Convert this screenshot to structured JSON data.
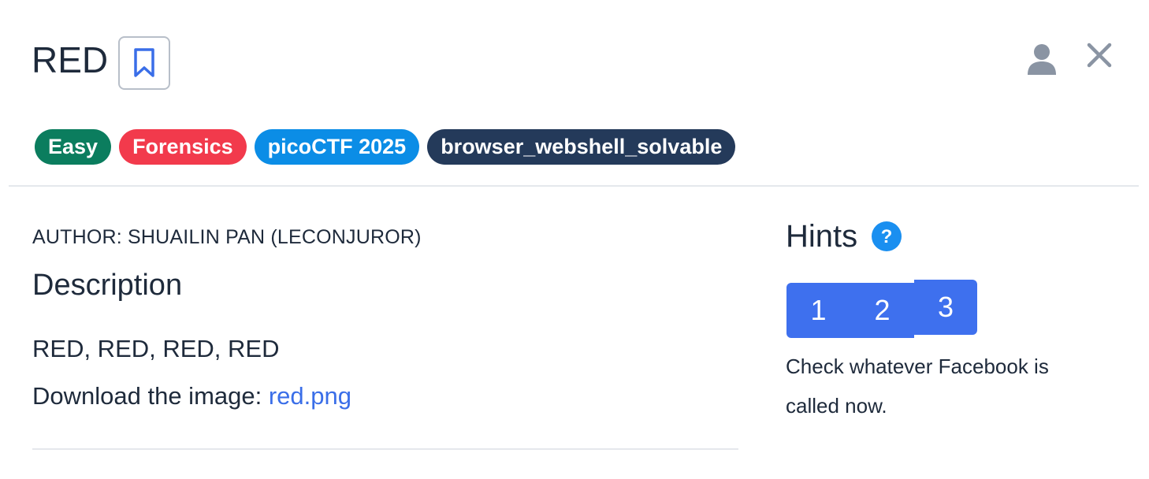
{
  "challenge": {
    "title": "RED",
    "author": "AUTHOR: SHUAILIN PAN (LECONJUROR)"
  },
  "header": {
    "bookmark_icon": "bookmark-icon",
    "user_icon": "user-icon",
    "close_icon": "close-icon"
  },
  "tags": [
    {
      "label": "Easy",
      "color": "#0b7d5e"
    },
    {
      "label": "Forensics",
      "color": "#f23a4c"
    },
    {
      "label": "picoCTF 2025",
      "color": "#0b8de6"
    },
    {
      "label": "browser_webshell_solvable",
      "color": "#243a5a"
    }
  ],
  "description": {
    "heading": "Description",
    "text": "RED, RED, RED, RED",
    "download_prefix": "Download the image: ",
    "download_link": "red.png"
  },
  "hints": {
    "heading": "Hints",
    "help_icon": "help-icon",
    "tabs": [
      "1",
      "2",
      "3"
    ],
    "active_text": "Check whatever Facebook is called now."
  },
  "colors": {
    "accent": "#3e70ee",
    "link": "#3a6ee8",
    "text": "#1e2a3b",
    "help": "#1a8ff0"
  }
}
